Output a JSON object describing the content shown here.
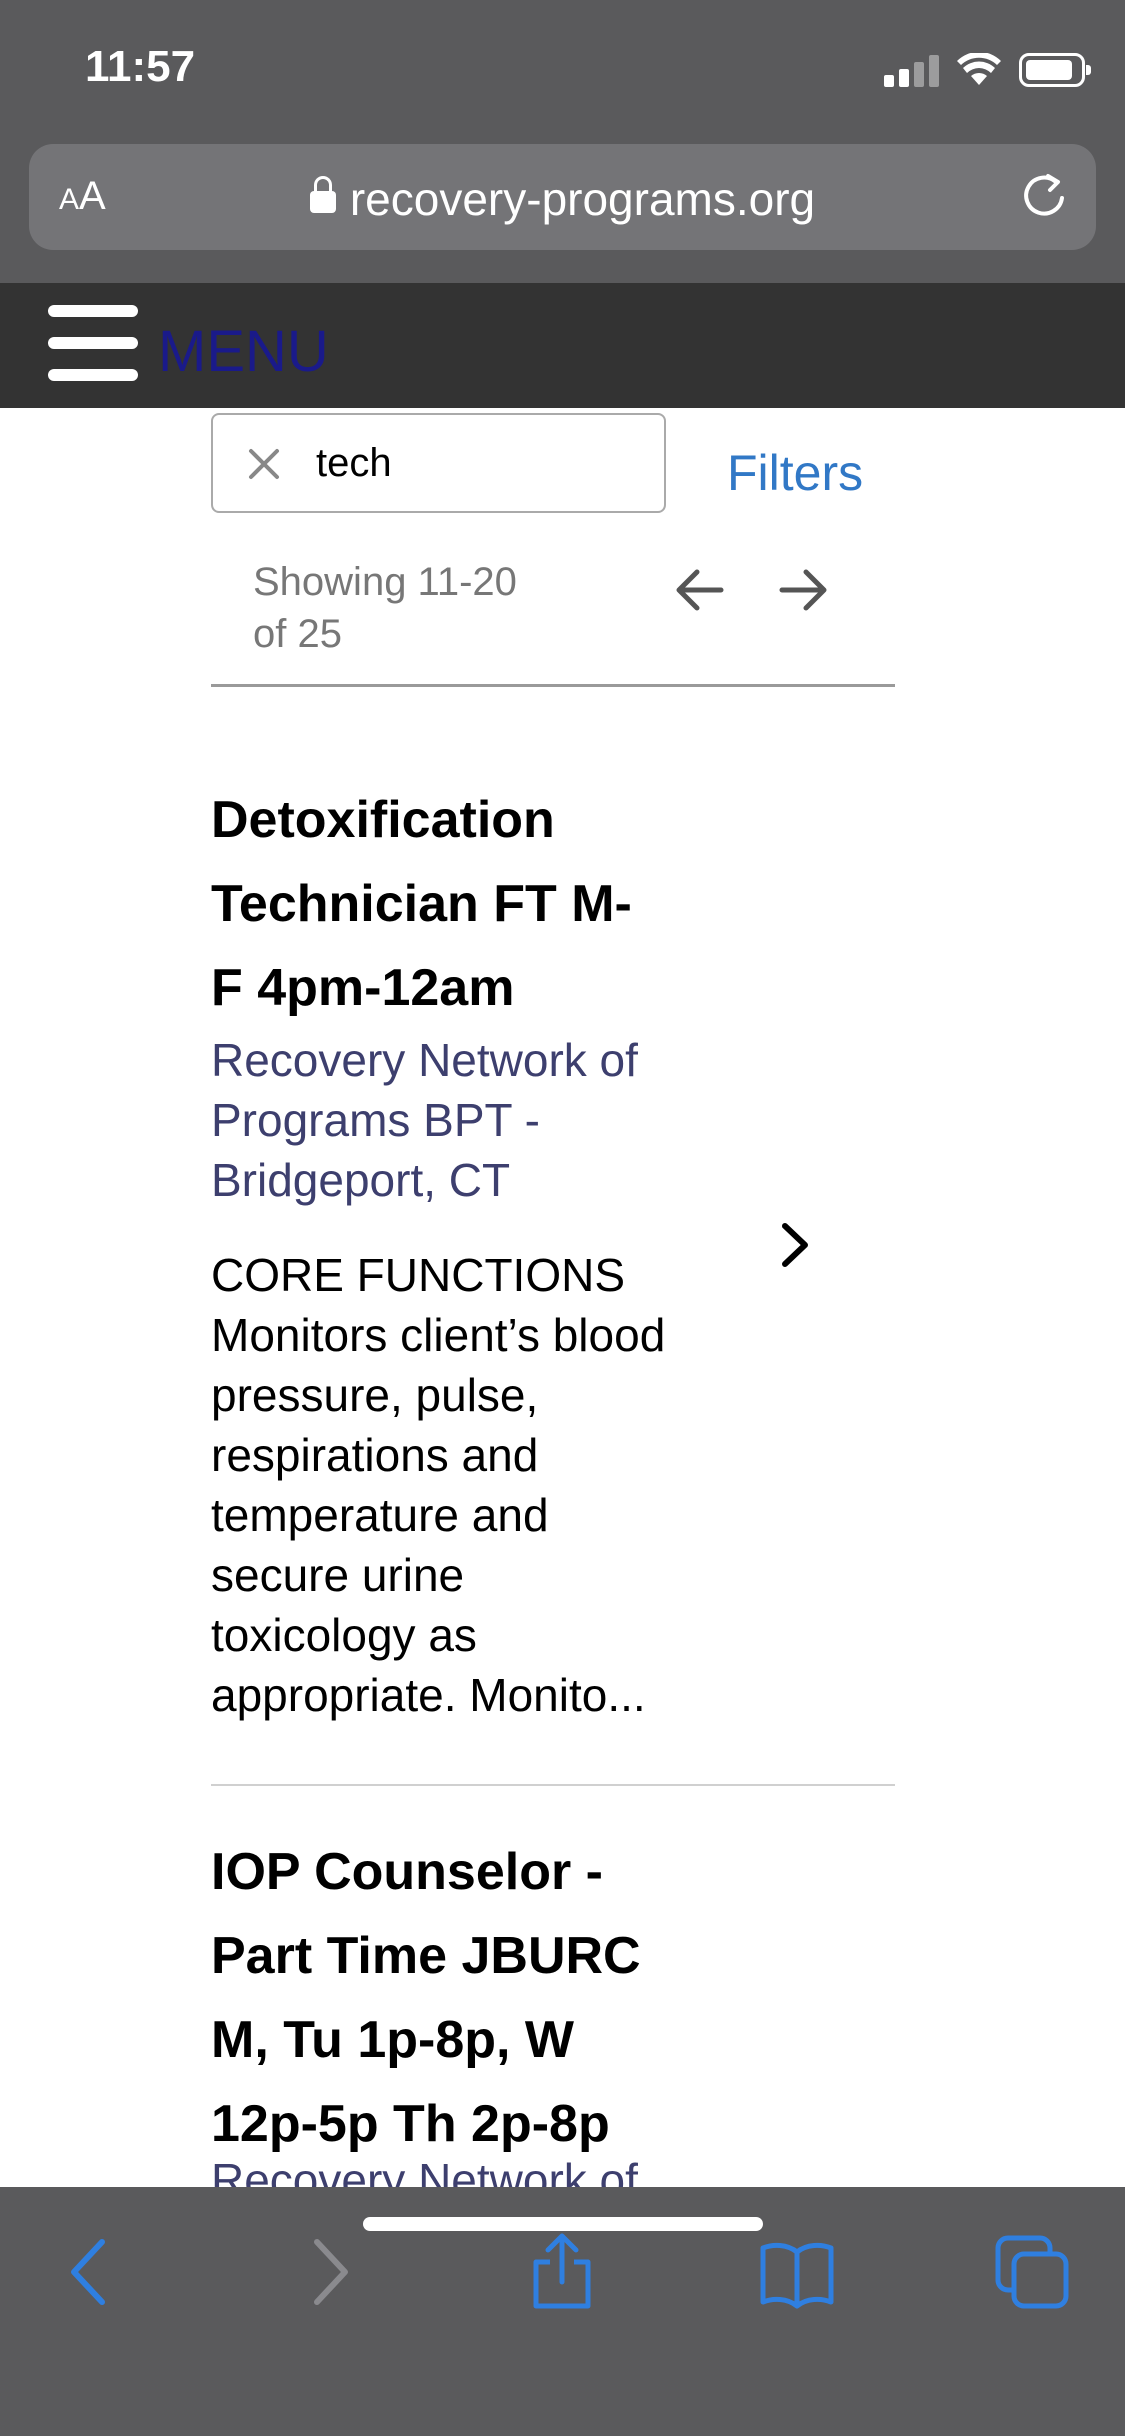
{
  "status_bar": {
    "time": "11:57"
  },
  "browser": {
    "text_size_label_small": "A",
    "text_size_label_large": "A",
    "url": "recovery-programs.org"
  },
  "site_header": {
    "menu_label": "MENU"
  },
  "search": {
    "value": "tech",
    "filters_label": "Filters"
  },
  "pagination": {
    "showing_line1": "Showing 11-20",
    "showing_line2": "of 25"
  },
  "listings": [
    {
      "title_lines": [
        "Detoxification",
        "Technician FT M-",
        "F 4pm-12am"
      ],
      "company_lines": [
        "Recovery Network of",
        "Programs BPT -",
        "Bridgeport, CT"
      ],
      "description_lines": [
        "CORE FUNCTIONS",
        "Monitors client’s blood",
        "pressure, pulse,",
        "respirations and",
        "temperature and",
        "secure urine",
        "toxicology as",
        "appropriate. Monito..."
      ]
    },
    {
      "title_lines": [
        "IOP Counselor -",
        "Part Time JBURC",
        "M, Tu 1p-8p, W",
        "12p-5p Th 2p-8p"
      ],
      "company_peek": "Recovery Network of"
    }
  ],
  "colors": {
    "chrome": "#5a5a5c",
    "header": "#333333",
    "menu_text": "#1a1a8a",
    "link": "#3178c6",
    "company": "#3d3f6e",
    "toolbar_icon": "#2f7fe0"
  },
  "icons": [
    "lock-icon",
    "reload-icon",
    "hamburger-icon",
    "clear-icon",
    "arrow-left-icon",
    "arrow-right-icon",
    "chevron-right-icon",
    "back-icon",
    "forward-icon",
    "share-icon",
    "bookmarks-icon",
    "tabs-icon"
  ]
}
